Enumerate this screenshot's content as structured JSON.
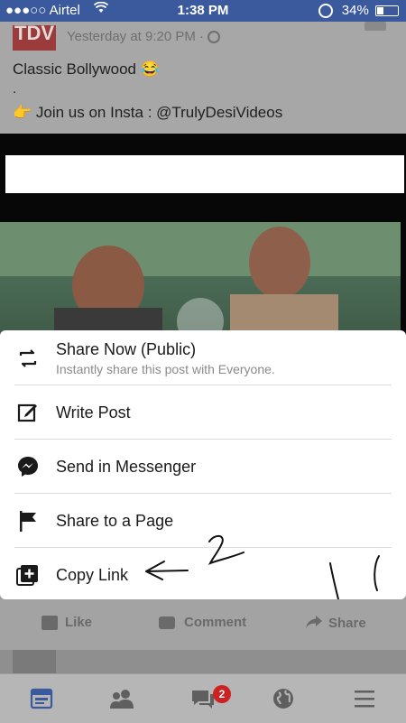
{
  "status_bar": {
    "carrier": "●●●○○ Airtel",
    "time": "1:38 PM",
    "battery": "34%",
    "battery_level": 0.34
  },
  "post": {
    "page_logo_text": "TDV",
    "timestamp": "Yesterday at 9:20 PM · ",
    "caption_line1": "Classic Bollywood 😂",
    "caption_line2": ".",
    "caption_line3": "👉 Join us on Insta : @TrulyDesiVideos"
  },
  "share_sheet": {
    "items": [
      {
        "label": "Share Now (Public)",
        "sublabel": "Instantly share this post with Everyone.",
        "icon": "repost-icon"
      },
      {
        "label": "Write Post",
        "icon": "compose-icon"
      },
      {
        "label": "Send in Messenger",
        "icon": "messenger-icon"
      },
      {
        "label": "Share to a Page",
        "icon": "flag-icon"
      },
      {
        "label": "Copy Link",
        "icon": "copy-link-icon"
      }
    ]
  },
  "annotations": {
    "number_2": "2"
  },
  "action_bar": {
    "like": "Like",
    "comment": "Comment",
    "share": "Share"
  },
  "tab_bar": {
    "items": [
      "news-feed-icon",
      "friends-icon",
      "messages-icon",
      "notifications-globe-icon",
      "menu-icon"
    ],
    "messages_badge": "2"
  }
}
